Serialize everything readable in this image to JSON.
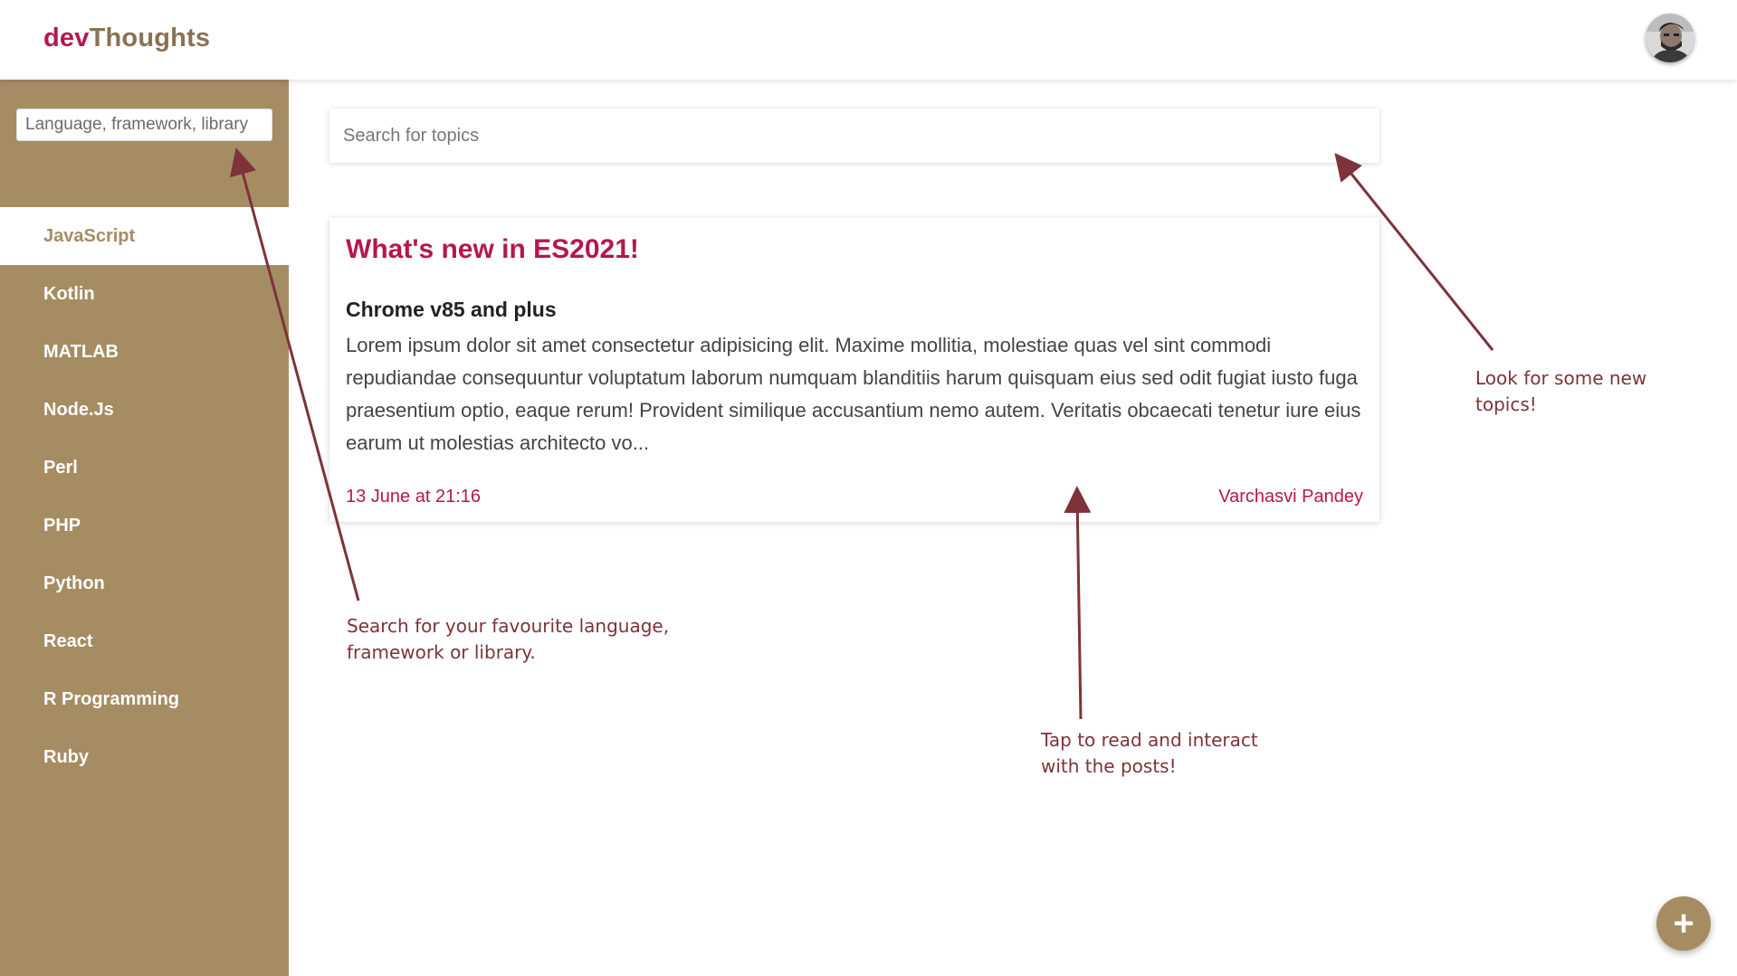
{
  "header": {
    "logo_part1": "dev",
    "logo_part2": "Thoughts",
    "avatar_icon": "user-avatar"
  },
  "sidebar": {
    "search_placeholder": "Language, framework, library",
    "items": [
      {
        "label": "JavaScript",
        "active": true
      },
      {
        "label": "Kotlin"
      },
      {
        "label": "MATLAB"
      },
      {
        "label": "Node.Js"
      },
      {
        "label": "Perl"
      },
      {
        "label": "PHP"
      },
      {
        "label": "Python"
      },
      {
        "label": "React"
      },
      {
        "label": "R Programming"
      },
      {
        "label": "Ruby"
      }
    ]
  },
  "main": {
    "search_placeholder": "Search for topics",
    "post": {
      "title": "What's new in ES2021!",
      "subtitle": "Chrome v85 and plus",
      "body": "Lorem ipsum dolor sit amet consectetur adipisicing elit. Maxime mollitia, molestiae quas vel sint commodi repudiandae consequuntur voluptatum laborum numquam blanditiis harum quisquam eius sed odit fugiat iusto fuga praesentium optio, eaque rerum! Provident similique accusantium nemo autem. Veritatis obcaecati tenetur iure eius earum ut molestias architecto vo...",
      "date": "13 June at 21:16",
      "author": "Varchasvi Pandey"
    }
  },
  "annotations": {
    "sidebar_search_line1": "Search for your favourite language,",
    "sidebar_search_line2": "framework or library.",
    "topics_line1": "Look for some new",
    "topics_line2": "topics!",
    "posts_line1": "Tap to read and interact",
    "posts_line2": "with the posts!"
  },
  "fab": {
    "label": "+",
    "icon": "plus-icon"
  },
  "colors": {
    "brand_red": "#b5174f",
    "sidebar_tan": "#a68c63",
    "annotation": "#7d3339"
  }
}
